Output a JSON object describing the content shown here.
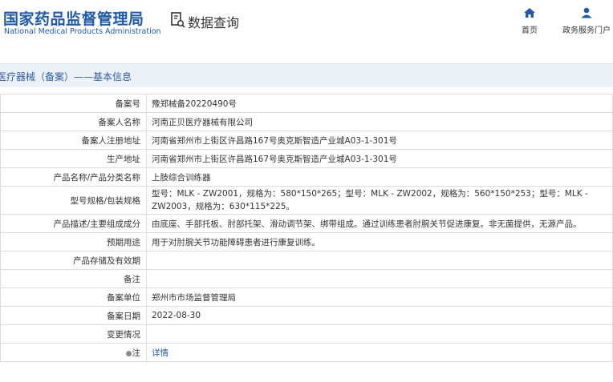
{
  "header": {
    "logo_cn": "国家药品监督管理局",
    "logo_en": "National Medical Products Administration",
    "query_label": "数据查询",
    "nav": [
      {
        "label": "首页",
        "icon": "home-icon"
      },
      {
        "label": "政务服务门户",
        "icon": "user-icon"
      }
    ]
  },
  "breadcrumb": "医疗器械（备案）——基本信息",
  "colors": {
    "brand": "#1f5ba8",
    "crumb_bg": "#ecf1f8",
    "border": "#dcdcdc"
  },
  "rows": [
    {
      "label": "备案号",
      "value": "豫郑械备20220490号"
    },
    {
      "label": "备案人名称",
      "value": "河南正贝医疗器械有限公司"
    },
    {
      "label": "备案人注册地址",
      "value": "河南省郑州市上街区许昌路167号奥克斯智造产业城A03-1-301号"
    },
    {
      "label": "生产地址",
      "value": "河南省郑州市上街区许昌路167号奥克斯智造产业城A03-1-301号"
    },
    {
      "label": "产品名称/产品分类名称",
      "value": "上肢综合训练器"
    },
    {
      "label": "型号规格/包装规格",
      "value": "型号：MLK - ZW2001，规格为：580*150*265；型号：MLK - ZW2002，规格为：560*150*253；型号：MLK - ZW2003，规格为：630*115*225。"
    },
    {
      "label": "产品描述/主要组成成分",
      "value": "由底座、手部托板、肘部托架、滑动调节架、绑带组成。通过训练患者肘腕关节促进康复。非无菌提供，无源产品。"
    },
    {
      "label": "预期用途",
      "value": "用于对肘腕关节功能障碍患者进行康复训练。"
    },
    {
      "label": "产品存储及有效期",
      "value": ""
    },
    {
      "label": "备注",
      "value": ""
    },
    {
      "label": "备案单位",
      "value": "郑州市市场监督管理局"
    },
    {
      "label": "备案日期",
      "value": "2022-08-30"
    },
    {
      "label": "变更情况",
      "value": ""
    },
    {
      "label": "注",
      "pin_icon": "pin-icon",
      "link": "详情"
    }
  ]
}
